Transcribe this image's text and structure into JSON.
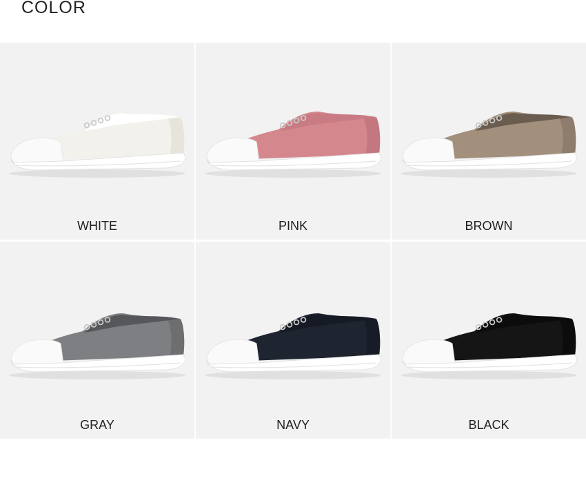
{
  "section": {
    "title": "COLOR"
  },
  "colors": [
    {
      "label": "WHITE",
      "upper": "#f3f1ec",
      "upper_shade": "#dcd8cf",
      "lining": "#ffffff"
    },
    {
      "label": "PINK",
      "upper": "#d5878e",
      "upper_shade": "#b46b73",
      "lining": "#c97b84"
    },
    {
      "label": "BROWN",
      "upper": "#a28f7c",
      "upper_shade": "#7e6e5e",
      "lining": "#6a5c4f"
    },
    {
      "label": "GRAY",
      "upper": "#7d7f82",
      "upper_shade": "#5e6063",
      "lining": "#55575a"
    },
    {
      "label": "NAVY",
      "upper": "#1e2430",
      "upper_shade": "#121620",
      "lining": "#161a24"
    },
    {
      "label": "BLACK",
      "upper": "#151515",
      "upper_shade": "#060606",
      "lining": "#0c0c0c"
    }
  ],
  "common": {
    "toe_cap": "#fafafa",
    "sole": "#ffffff",
    "eyelet": "#c9c9c9"
  }
}
